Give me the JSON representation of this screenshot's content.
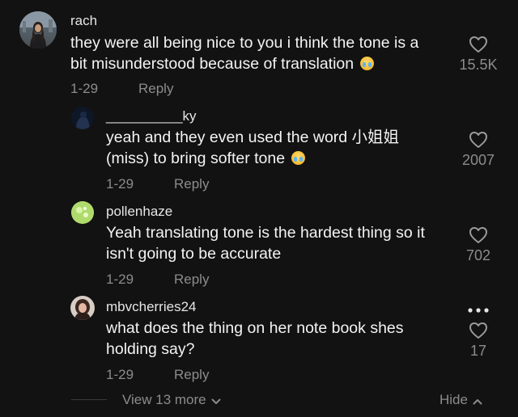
{
  "comments": [
    {
      "username": "rach",
      "text_line1": "they were all being nice to you i think the tone is a",
      "text_line2": "bit misunderstood because of translation",
      "emoji_icon": "loudly-crying-face",
      "date": "1-29",
      "reply_label": "Reply",
      "likes": "15.5K"
    },
    {
      "username": "__________ky",
      "text_line1": "yeah and they even used the word 小姐姐",
      "text_line2": "(miss) to bring softer tone",
      "emoji_icon": "loudly-crying-face",
      "date": "1-29",
      "reply_label": "Reply",
      "likes": "2007"
    },
    {
      "username": "pollenhaze",
      "text_line1": "Yeah translating tone is the hardest thing so it",
      "text_line2": "isn't going to be accurate",
      "date": "1-29",
      "reply_label": "Reply",
      "likes": "702"
    },
    {
      "username": "mbvcherries24",
      "text_line1": "what does the thing on her note book shes",
      "text_line2": "holding say?",
      "date": "1-29",
      "reply_label": "Reply",
      "likes": "17"
    }
  ],
  "footer": {
    "view_more_label": "View 13 more",
    "hide_label": "Hide"
  },
  "colors": {
    "background": "#121212",
    "text": "#f3f3f3",
    "muted": "#8c8c8c"
  },
  "icons": [
    "heart-icon",
    "more-options-icon",
    "chevron-down-icon",
    "chevron-up-icon",
    "loudly-crying-face-emoji"
  ]
}
